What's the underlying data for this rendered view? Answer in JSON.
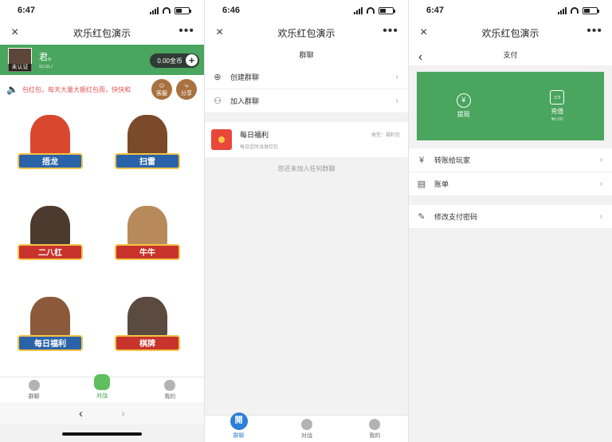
{
  "screen1": {
    "status_time": "6:47",
    "title": "欢乐红包演示",
    "close_icon": "×",
    "more_icon": "•••",
    "profile": {
      "name": "君。",
      "id": "ID:317",
      "avatar_badge": "未认证",
      "coins": "0.00金币",
      "plus": "+"
    },
    "notice": "包红包，每天大量大额红包雨，快快和",
    "speaker": "🔈",
    "service_label": "客服",
    "share_label": "分享",
    "games": [
      {
        "label": "捂龙"
      },
      {
        "label": "扫雷"
      },
      {
        "label": "二八杠"
      },
      {
        "label": "牛牛"
      },
      {
        "label": "每日福利"
      },
      {
        "label": "棋牌"
      }
    ],
    "tabs": [
      "群聊",
      "对战",
      "我的"
    ],
    "nav_back": "‹",
    "nav_forward": "›"
  },
  "screen2": {
    "status_time": "6:46",
    "title": "欢乐红包演示",
    "close_icon": "×",
    "more_icon": "•••",
    "subtitle": "群聊",
    "create_group": "创建群聊",
    "join_group": "加入群聊",
    "chevron": "›",
    "group": {
      "name": "每日福利",
      "desc": "每日定时派发红包",
      "type": "类型：福利包"
    },
    "empty_text": "您还未加入任何群聊",
    "tabs": [
      "群聊",
      "对战",
      "我的"
    ],
    "active_tab_glyph": "開"
  },
  "screen3": {
    "status_time": "6:47",
    "title": "欢乐红包演示",
    "close_icon": "×",
    "more_icon": "•••",
    "back_icon": "‹",
    "subtitle": "支付",
    "withdraw": {
      "label": "提现",
      "icon": "¥"
    },
    "recharge": {
      "label": "充值",
      "amount": "¥0.00"
    },
    "rows": [
      {
        "label": "转账给玩家",
        "icon": "¥"
      },
      {
        "label": "账单",
        "icon": "▤"
      }
    ],
    "change_password": "修改支付密码",
    "pencil_icon": "✎",
    "chevron": "›"
  },
  "colors": {
    "brand_green": "#4aa55e",
    "coin_pill": "#2f3b34",
    "notice_red": "#e25555",
    "active_blue": "#2d7ed6"
  }
}
